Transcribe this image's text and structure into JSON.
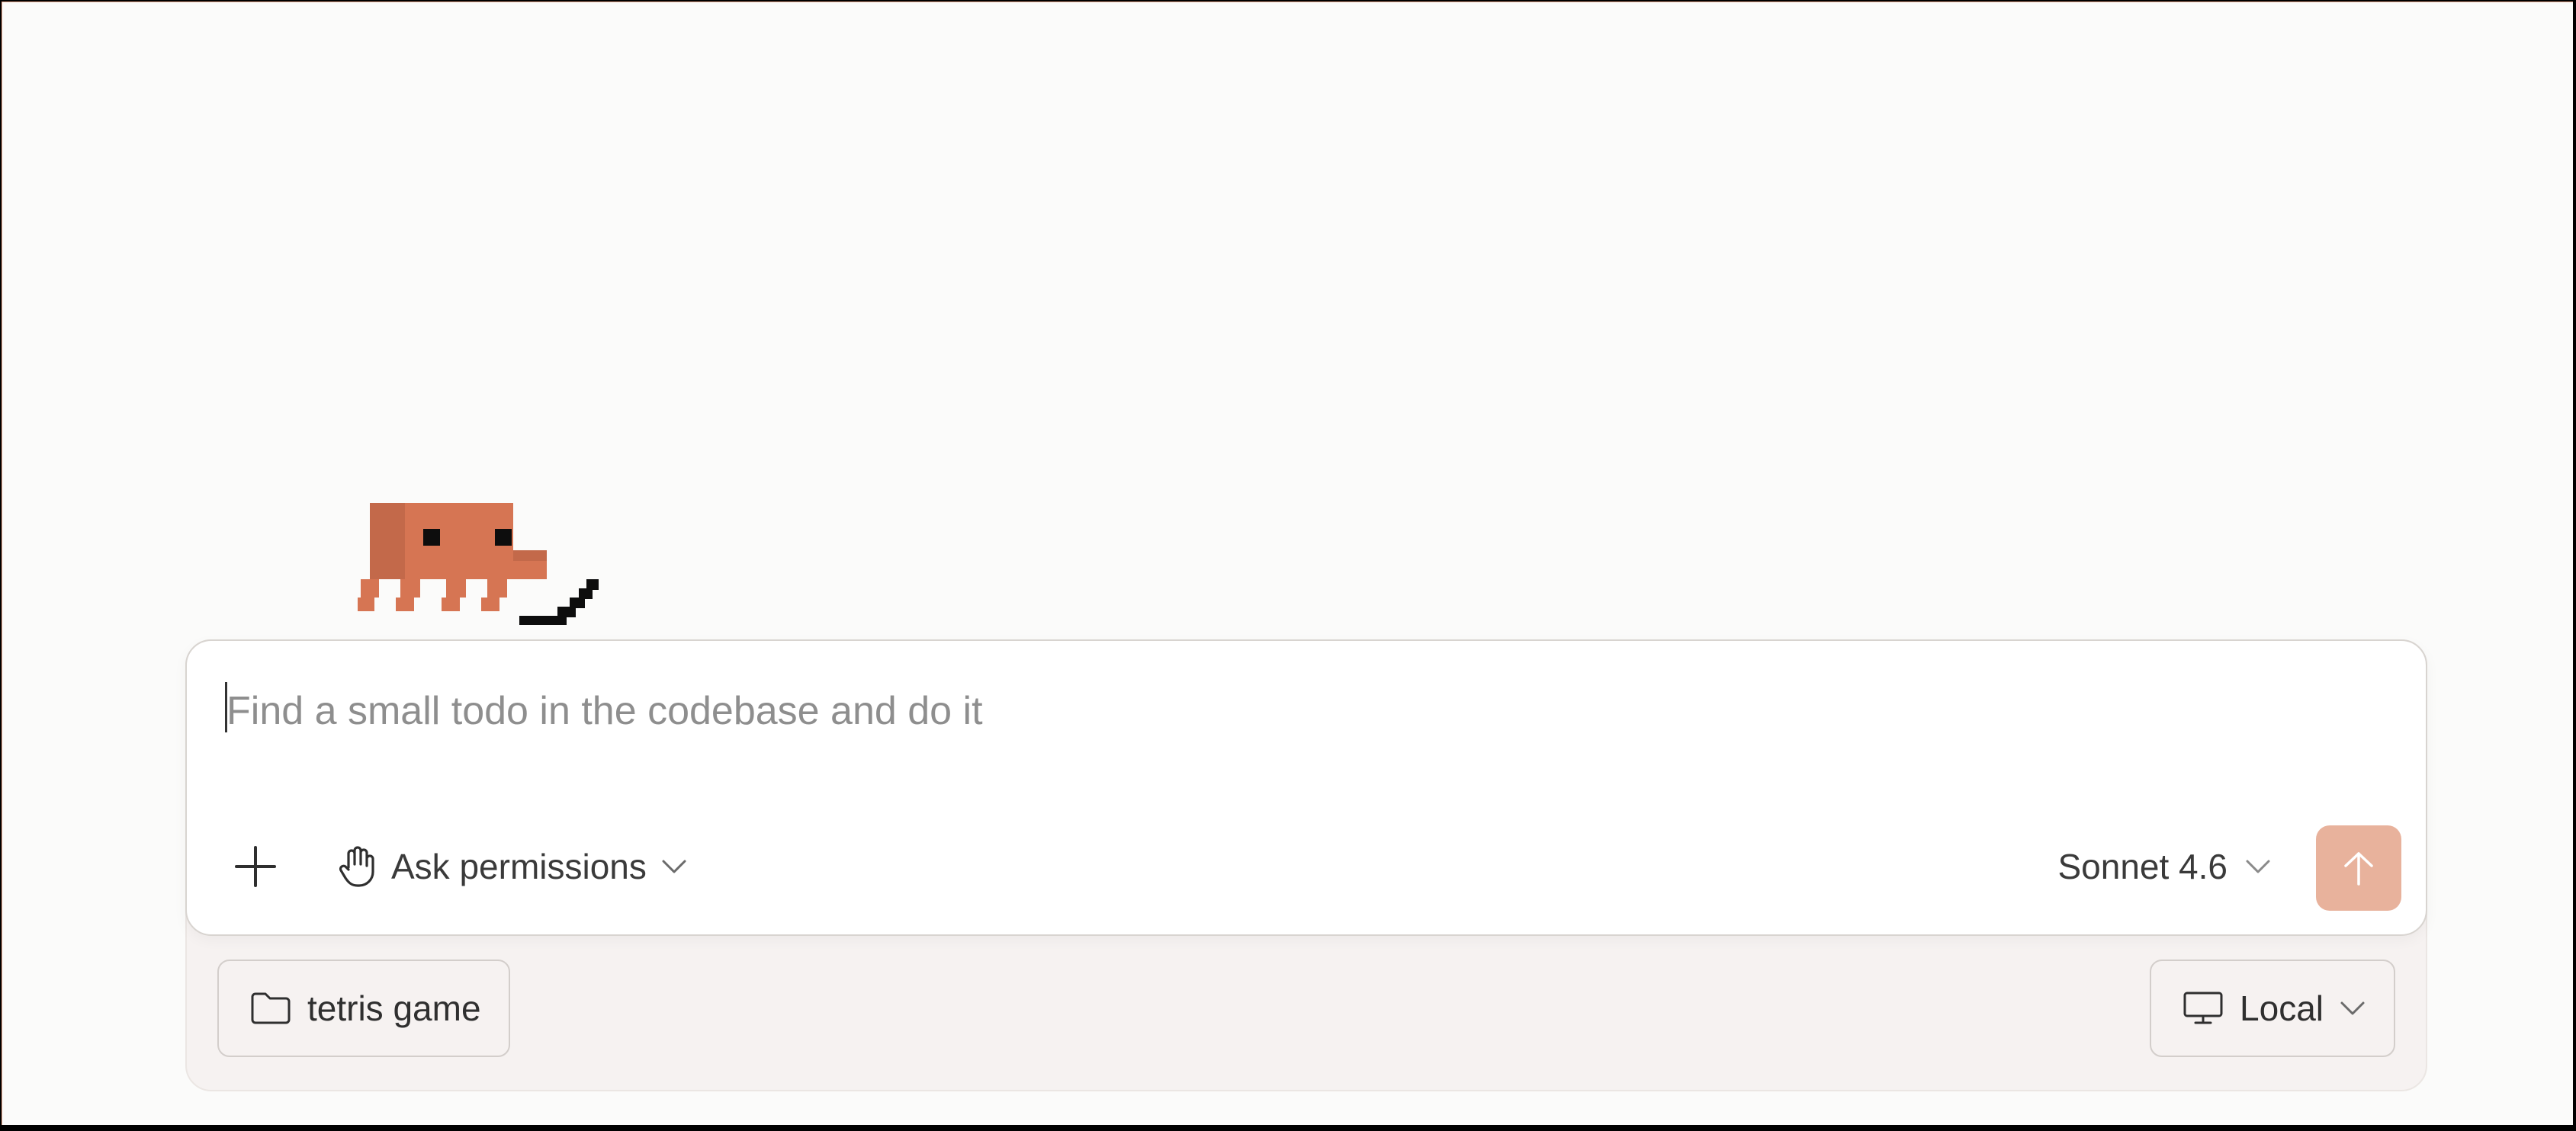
{
  "composer": {
    "placeholder": "Find a small todo in the codebase and do it",
    "add_icon": "plus-icon",
    "permission_icon": "hand-icon",
    "permission_label": "Ask permissions",
    "model_label": "Sonnet 4.6",
    "send_icon": "arrow-up-icon"
  },
  "context": {
    "folder_icon": "folder-icon",
    "folder_label": "tetris game",
    "environment_icon": "monitor-icon",
    "environment_label": "Local"
  },
  "colors": {
    "mascot": "#d67553",
    "mascot_shadow": "#b9603f",
    "send_button": "#e8b29c",
    "background": "#fbfbfa",
    "composer_tray": "#f6f2f1"
  }
}
